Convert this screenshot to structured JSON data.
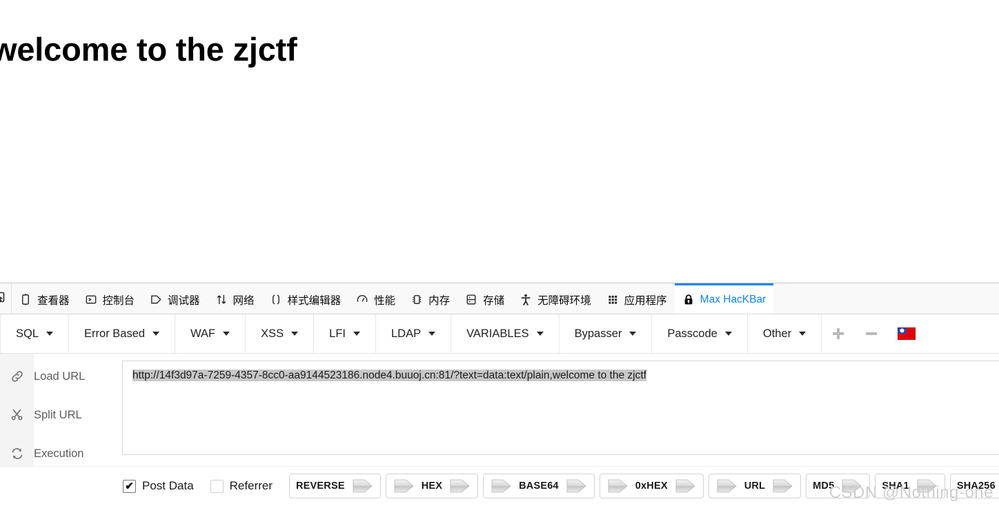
{
  "page": {
    "heading": "welcome to the zjctf"
  },
  "devtools": {
    "picker_icon": "element-picker-icon",
    "tabs": [
      {
        "label": "查看器",
        "icon": "inspector-icon",
        "active": false
      },
      {
        "label": "控制台",
        "icon": "console-icon",
        "active": false
      },
      {
        "label": "调试器",
        "icon": "debugger-icon",
        "active": false
      },
      {
        "label": "网络",
        "icon": "network-icon",
        "active": false
      },
      {
        "label": "样式编辑器",
        "icon": "style-editor-icon",
        "active": false
      },
      {
        "label": "性能",
        "icon": "performance-icon",
        "active": false
      },
      {
        "label": "内存",
        "icon": "memory-icon",
        "active": false
      },
      {
        "label": "存储",
        "icon": "storage-icon",
        "active": false
      },
      {
        "label": "无障碍环境",
        "icon": "accessibility-icon",
        "active": false
      },
      {
        "label": "应用程序",
        "icon": "application-icon",
        "active": false
      },
      {
        "label": "Max HacKBar",
        "icon": "lock-icon",
        "active": true
      }
    ],
    "active_tab_color": "#0a84ff"
  },
  "hackbar": {
    "dropdowns": [
      {
        "label": "SQL"
      },
      {
        "label": "Error Based"
      },
      {
        "label": "WAF"
      },
      {
        "label": "XSS"
      },
      {
        "label": "LFI"
      },
      {
        "label": "LDAP"
      },
      {
        "label": "VARIABLES"
      },
      {
        "label": "Bypasser"
      },
      {
        "label": "Passcode"
      },
      {
        "label": "Other"
      }
    ],
    "add_button": "+",
    "remove_button": "−",
    "flag_icon": "taiwan-flag-icon",
    "actions": [
      {
        "label": "Load URL",
        "icon": "link-icon"
      },
      {
        "label": "Split URL",
        "icon": "scissors-icon"
      },
      {
        "label": "Execution",
        "icon": "refresh-icon"
      }
    ],
    "url_value": "http://14f3d97a-7259-4357-8cc0-aa9144523186.node4.buuoj.cn:81/?text=data:text/plain,welcome to the zjctf",
    "url_placeholder": "",
    "url_selected": true,
    "checkboxes": [
      {
        "label": "Post Data",
        "checked": true
      },
      {
        "label": "Referrer",
        "checked": false
      }
    ],
    "encoders": [
      {
        "label": "REVERSE",
        "left_arrow": false,
        "right_arrow": true
      },
      {
        "label": "HEX",
        "left_arrow": true,
        "right_arrow": true
      },
      {
        "label": "BASE64",
        "left_arrow": true,
        "right_arrow": true
      },
      {
        "label": "0xHEX",
        "left_arrow": true,
        "right_arrow": true
      },
      {
        "label": "URL",
        "left_arrow": true,
        "right_arrow": true
      },
      {
        "label": "MD5",
        "left_arrow": false,
        "right_arrow": true
      },
      {
        "label": "SHA1",
        "left_arrow": false,
        "right_arrow": true
      },
      {
        "label": "SHA256",
        "left_arrow": false,
        "right_arrow": true
      }
    ]
  },
  "watermark": "CSDN @Nothing-one"
}
